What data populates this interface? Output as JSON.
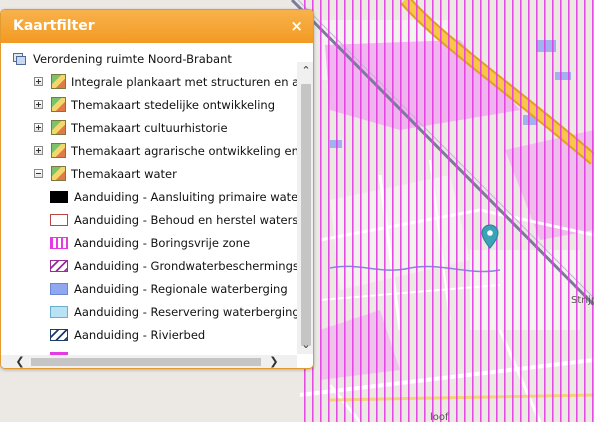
{
  "panel": {
    "title": "Kaartfilter",
    "close_label": "×"
  },
  "tree": {
    "root_label": "Verordening ruimte Noord-Brabant",
    "layers": [
      {
        "label": "Integrale plankaart met structuren en aanduidingen",
        "expanded": false
      },
      {
        "label": "Themakaart stedelijke ontwikkeling",
        "expanded": false
      },
      {
        "label": "Themakaart cultuurhistorie",
        "expanded": false
      },
      {
        "label": "Themakaart agrarische ontwikkeling en windturbines",
        "expanded": false
      },
      {
        "label": "Themakaart water",
        "expanded": true
      }
    ],
    "legend": [
      {
        "label": "Aanduiding - Aansluiting primaire waterkering",
        "style": "solid-black"
      },
      {
        "label": "Aanduiding - Behoud en herstel watersystemen",
        "style": "outline-red"
      },
      {
        "label": "Aanduiding - Boringsvrije zone",
        "style": "vertical-magenta"
      },
      {
        "label": "Aanduiding - Grondwaterbeschermingsgebied",
        "style": "diagonal-purple"
      },
      {
        "label": "Aanduiding - Regionale waterberging",
        "style": "fill-blue"
      },
      {
        "label": "Aanduiding - Reservering waterberging",
        "style": "fill-lightblue"
      },
      {
        "label": "Aanduiding - Rivierbed",
        "style": "diagonal-navy"
      },
      {
        "label": "",
        "style": "fill-magenta"
      }
    ]
  },
  "map": {
    "labels": [
      "Strijp",
      "loof"
    ],
    "marker_icon": "map-pin-icon"
  },
  "icons": {
    "close": "close-icon",
    "expand": "expand-plus-icon",
    "collapse": "collapse-minus-icon",
    "layer": "layer-icon",
    "root": "layers-root-icon"
  },
  "colors": {
    "header": "#f4a234",
    "hatch_magenta": "#e43ae3",
    "road_orange": "#f5b73c",
    "marker": "#3aa3b7"
  }
}
